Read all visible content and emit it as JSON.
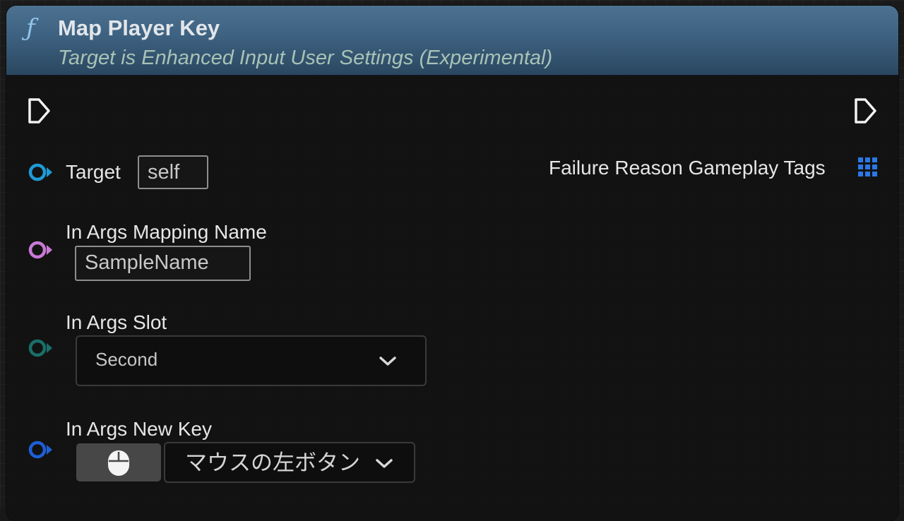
{
  "node": {
    "icon": "function-icon",
    "title": "Map Player Key",
    "subtitle": "Target is Enhanced Input User Settings (Experimental)",
    "header_color": "#3d6180"
  },
  "pins": {
    "exec_in_icon": "exec-arrow-icon",
    "exec_out_icon": "exec-arrow-icon",
    "target": {
      "label": "Target",
      "value": "self",
      "color": "#1e9bd7"
    },
    "mapping_name": {
      "label": "In Args Mapping Name",
      "value": "SampleName",
      "color": "#c87ad6"
    },
    "slot": {
      "label": "In Args Slot",
      "selected": "Second",
      "color": "#1a6f6a"
    },
    "new_key": {
      "label": "In Args New Key",
      "selected": "マウスの左ボタン",
      "key_icon": "mouse-icon",
      "color": "#1d5fd6"
    },
    "failure_tags": {
      "label": "Failure Reason Gameplay Tags",
      "icon": "gameplay-tags-container-icon",
      "color": "#1f6fe0"
    }
  }
}
